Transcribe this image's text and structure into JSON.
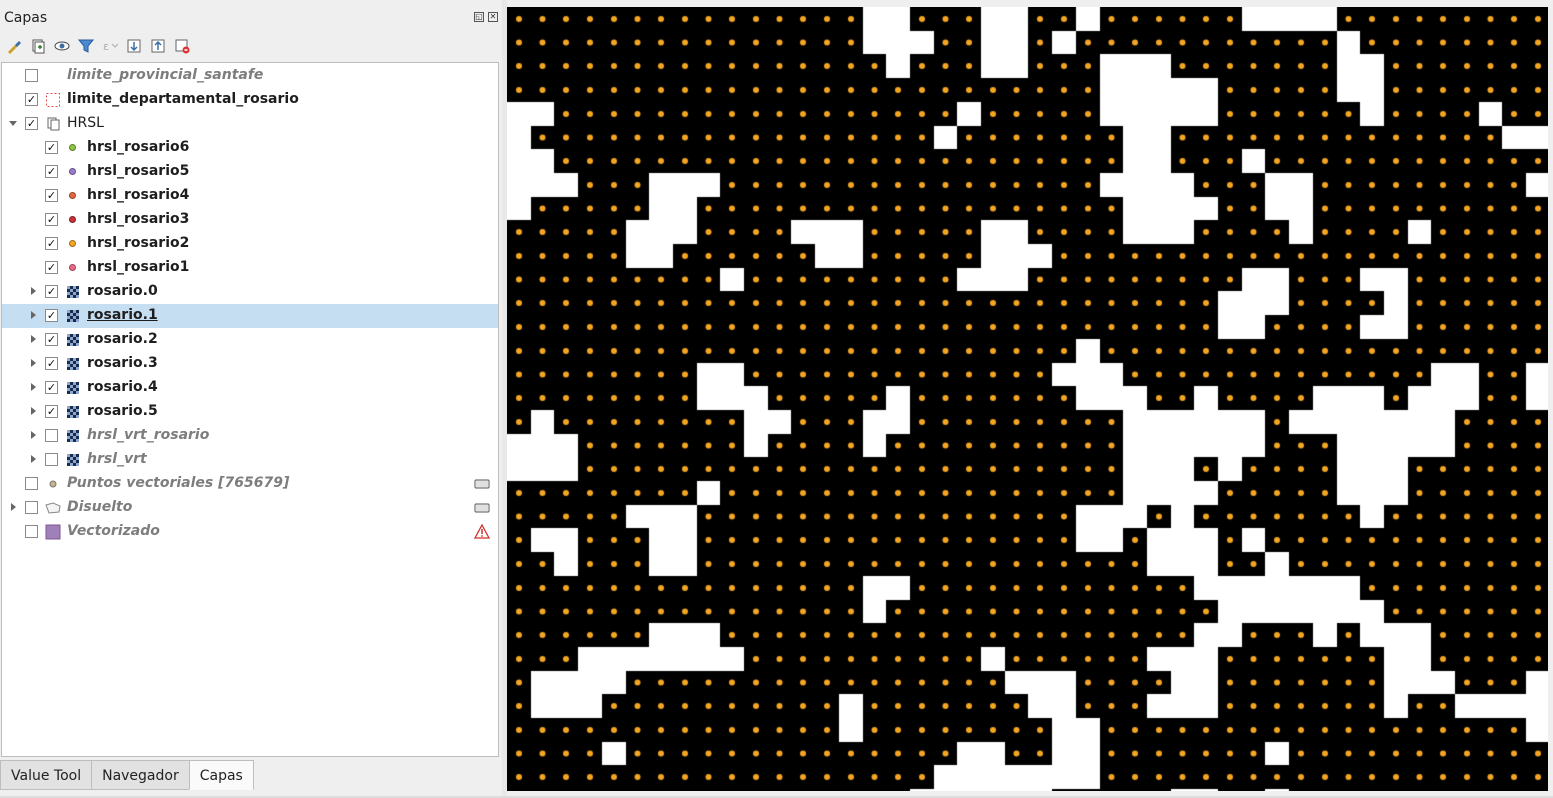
{
  "panel": {
    "title": "Capas"
  },
  "toolbar": {
    "buttons": [
      "style-manager-icon",
      "add-group-icon",
      "visibility-icon",
      "filter-legend-icon",
      "filter-expression-icon",
      "expand-all-icon",
      "collapse-all-icon",
      "remove-layer-icon"
    ]
  },
  "layers": [
    {
      "label": "limite_provincial_santafe",
      "checked": false,
      "inactive": true,
      "icon": "polygon-icon"
    },
    {
      "label": "limite_departamental_rosario",
      "checked": true,
      "inactive": false,
      "icon": "dashed-polygon-icon"
    },
    {
      "label": "HRSL",
      "checked": true,
      "group": true,
      "icon": "group-icon"
    },
    {
      "label": "hrsl_rosario6",
      "checked": true,
      "dot_color": "#8fc43c"
    },
    {
      "label": "hrsl_rosario5",
      "checked": true,
      "dot_color": "#9a7bd0"
    },
    {
      "label": "hrsl_rosario4",
      "checked": true,
      "dot_color": "#e5683d"
    },
    {
      "label": "hrsl_rosario3",
      "checked": true,
      "dot_color": "#c8323a"
    },
    {
      "label": "hrsl_rosario2",
      "checked": true,
      "dot_color": "#f5a623"
    },
    {
      "label": "hrsl_rosario1",
      "checked": true,
      "dot_color": "#e86a86"
    },
    {
      "label": "rosario.0",
      "checked": true,
      "raster": true
    },
    {
      "label": "rosario.1",
      "checked": true,
      "raster": true,
      "selected": true
    },
    {
      "label": "rosario.2",
      "checked": true,
      "raster": true
    },
    {
      "label": "rosario.3",
      "checked": true,
      "raster": true
    },
    {
      "label": "rosario.4",
      "checked": true,
      "raster": true
    },
    {
      "label": "rosario.5",
      "checked": true,
      "raster": true
    },
    {
      "label": "hrsl_vrt_rosario",
      "checked": false,
      "raster": true,
      "inactive": true
    },
    {
      "label": "hrsl_vrt",
      "checked": false,
      "raster": true,
      "inactive": true
    },
    {
      "label": "Puntos vectoriales [765679]",
      "checked": false,
      "inactive": true,
      "icon": "point-layer-icon",
      "right_icon": "temporary-layer-icon"
    },
    {
      "label": "Disuelto",
      "checked": false,
      "inactive": true,
      "icon": "polygon-outline-icon",
      "right_icon": "temporary-layer-icon"
    },
    {
      "label": "Vectorizado",
      "checked": false,
      "inactive": true,
      "icon": "filled-polygon-icon",
      "right_icon": "warning-icon"
    }
  ],
  "tabs": [
    {
      "label": "Value Tool",
      "active": false
    },
    {
      "label": "Navegador",
      "active": false
    },
    {
      "label": "Capas",
      "active": true
    }
  ],
  "map": {
    "background": "#ffffff",
    "cell_color": "#000000",
    "point_color": "#f5a623"
  }
}
